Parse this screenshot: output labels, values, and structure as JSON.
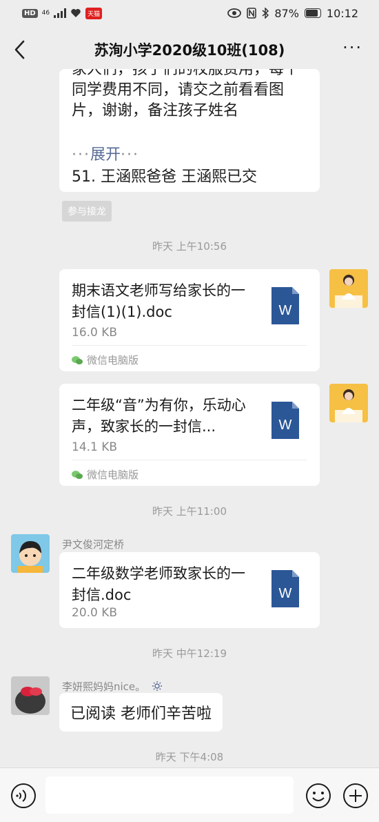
{
  "status_bar": {
    "hd": "HD",
    "signal": "46",
    "app_badge": "天猫",
    "battery": "87%",
    "time": "10:12"
  },
  "nav": {
    "title": "苏洵小学2020级10班(108)"
  },
  "top_message": {
    "lines": [
      "家人们，孩子们的校服费用，每个",
      "同学费用不同，请交之前看看图",
      "片，谢谢，备注孩子姓名"
    ],
    "expand_label": "展开",
    "signed_line": "51. 王涵熙爸爸 王涵熙已交",
    "join_button": "参与接龙"
  },
  "timestamps": [
    "昨天 上午10:56",
    "昨天 上午11:00",
    "昨天 中午12:19",
    "昨天 下午4:08"
  ],
  "file_messages": [
    {
      "name": "期末语文老师写给家长的一封信(1)(1).doc",
      "size": "16.0 KB",
      "source": "微信电脑版"
    },
    {
      "name": "二年级“音”为有你，乐动心声，致家长的一封信...",
      "size": "14.1 KB",
      "source": "微信电脑版"
    },
    {
      "name": "二年级数学老师致家长的一封信.doc",
      "size": "20.0 KB"
    }
  ],
  "senders": {
    "math_sender": "尹文俊河定桥",
    "reply_sender": "李妍熙妈妈nice。"
  },
  "reply_text": "已阅读 老师们辛苦啦",
  "colors": {
    "background": "#ededed",
    "link": "#576b95",
    "word_blue": "#2b5797"
  }
}
